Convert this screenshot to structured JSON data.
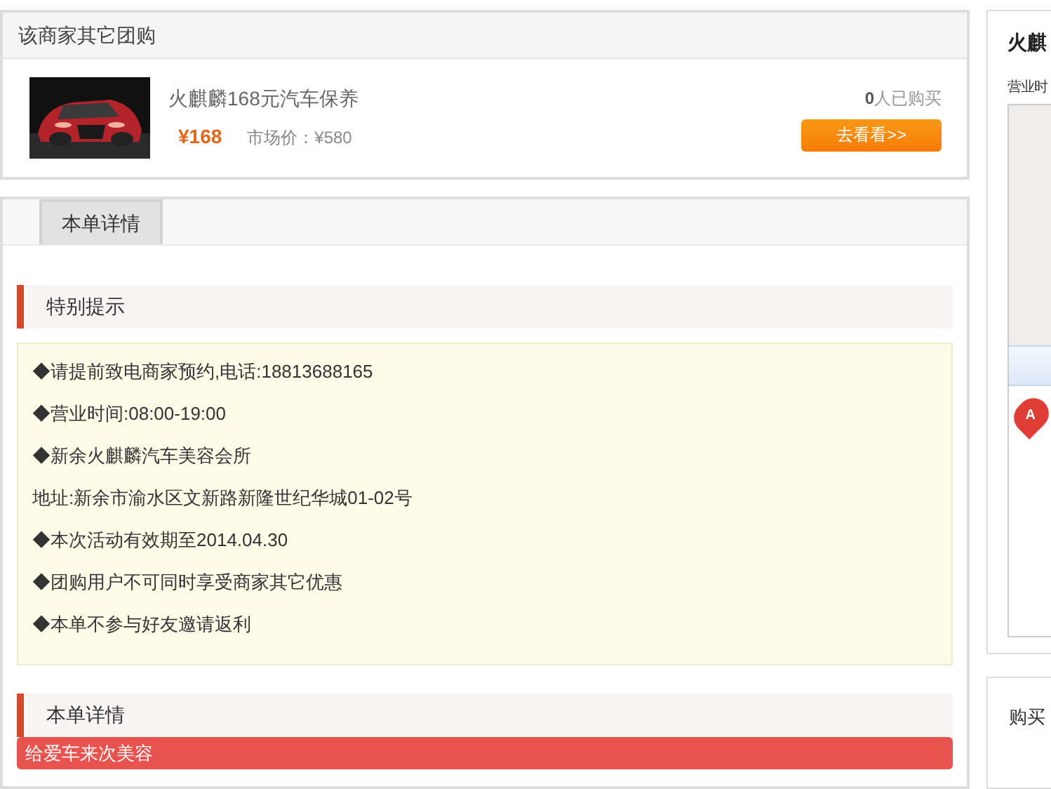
{
  "other_deals": {
    "title": "该商家其它团购",
    "items": [
      {
        "kind": "picture",
        "name": "火麒麟168元汽车保养",
        "price": "¥168",
        "market_price": "市场价：¥580",
        "sold_count": "0",
        "sold_suffix": "人已购买",
        "button": "去看看>>"
      }
    ]
  },
  "tabs": [
    {
      "label": "本单详情",
      "selected": true
    }
  ],
  "sections": [
    {
      "heading": "特别提示",
      "kind": "notice",
      "lines": [
        "◆请提前致电商家预约,电话:18813688165",
        "◆营业时间:08:00-19:00",
        "◆新余火麒麟汽车美容会所",
        "地址:新余市渝水区文新路新隆世纪华城01-02号",
        "◆本次活动有效期至2014.04.30",
        "◆团购用户不可同时享受商家其它优惠",
        "◆本单不参与好友邀请返利"
      ]
    },
    {
      "heading": "本单详情",
      "kind": "detail",
      "banner": "给爱车来次美容"
    }
  ],
  "side": {
    "title": "火麒",
    "hours_label": "营业时",
    "marker_label": "A",
    "buyers_title": "购买"
  }
}
